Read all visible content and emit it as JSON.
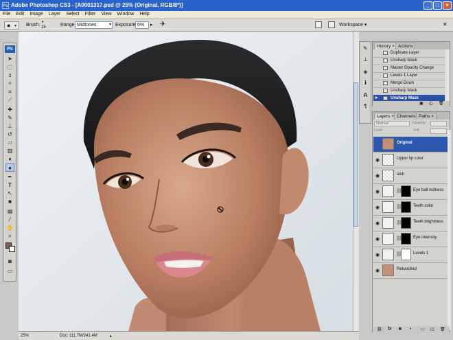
{
  "window": {
    "title": "Adobe Photoshop CS3 - [A0001317.psd @ 25% (Original, RGB/8*)]",
    "app_badge": "Ps"
  },
  "menu": [
    "File",
    "Edit",
    "Image",
    "Layer",
    "Select",
    "Filter",
    "View",
    "Window",
    "Help"
  ],
  "options": {
    "brush_label": "Brush:",
    "brush_size": "15",
    "range_label": "Range:",
    "range_value": "Midtones",
    "exposure_label": "Exposure:",
    "exposure_value": "6%",
    "workspace_label": "Workspace"
  },
  "history": {
    "tabs": [
      "History",
      "Actions"
    ],
    "items": [
      {
        "label": "Duplicate Layer",
        "selected": false
      },
      {
        "label": "Unsharp Mask",
        "selected": false
      },
      {
        "label": "Master Opacity Change",
        "selected": false
      },
      {
        "label": "Levels 1 Layer",
        "selected": false
      },
      {
        "label": "Merge Down",
        "selected": false
      },
      {
        "label": "Unsharp Mask",
        "selected": false
      },
      {
        "label": "Unsharp Mask",
        "selected": true
      }
    ]
  },
  "layers": {
    "tabs": [
      "Layers",
      "Channels",
      "Paths"
    ],
    "blend_mode": "Normal",
    "opacity_label": "Opacity:",
    "lock_label": "Lock:",
    "fill_label": "Fill:",
    "items": [
      {
        "name": "Original",
        "kind": "photo",
        "selected": true,
        "visible": false
      },
      {
        "name": "Upper lip color",
        "kind": "transparent",
        "selected": false,
        "visible": true
      },
      {
        "name": "lash",
        "kind": "transparent",
        "selected": false,
        "visible": true
      },
      {
        "name": "Eye ball redness",
        "kind": "adjust-mask-black",
        "selected": false,
        "visible": true
      },
      {
        "name": "Teeth color",
        "kind": "adjust-mask-black",
        "selected": false,
        "visible": true
      },
      {
        "name": "Teeth brightness",
        "kind": "adjust-mask-black",
        "selected": false,
        "visible": true
      },
      {
        "name": "Eye Intensity",
        "kind": "adjust-mask-black",
        "selected": false,
        "visible": true
      },
      {
        "name": "Levels 1",
        "kind": "adjust-mask-white",
        "selected": false,
        "visible": true
      },
      {
        "name": "Retouched",
        "kind": "photo",
        "selected": false,
        "visible": true
      }
    ]
  },
  "status": {
    "zoom": "25%",
    "doc_info": "Doc: 111.7M/241.4M"
  },
  "colors": {
    "title_bar": "#2a62cc",
    "selection": "#2e57b0",
    "foreground_swatch": "#8a5a55"
  }
}
